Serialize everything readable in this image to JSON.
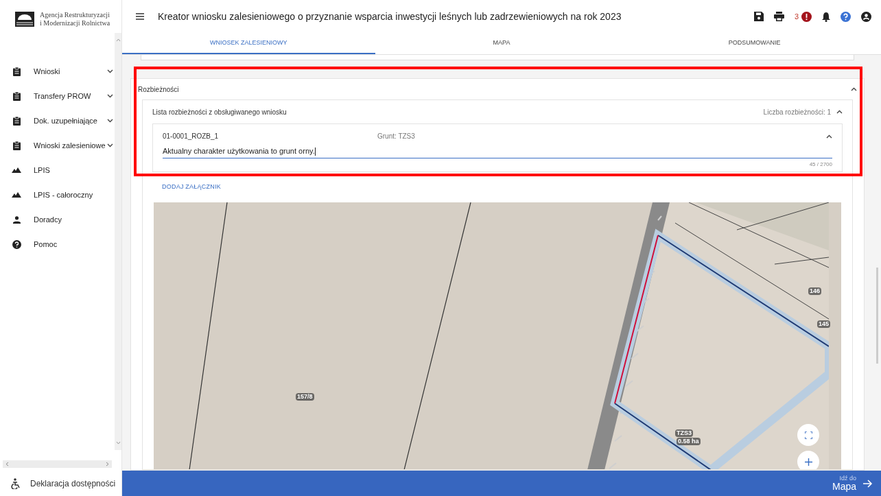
{
  "sidebar": {
    "logo_text": [
      "Agencja Restrukturyzacji",
      "i Modernizacji Rolnictwa"
    ],
    "items": [
      {
        "label": "Wnioski",
        "kind": "submenu"
      },
      {
        "label": "Transfery PROW",
        "kind": "submenu"
      },
      {
        "label": "Dok. uzupełniające",
        "kind": "submenu"
      },
      {
        "label": "Wnioski zalesieniowe",
        "kind": "submenu"
      },
      {
        "label": "LPIS",
        "kind": "link"
      },
      {
        "label": "LPIS - całoroczny",
        "kind": "link"
      },
      {
        "label": "Doradcy",
        "kind": "link"
      },
      {
        "label": "Pomoc",
        "kind": "link"
      }
    ],
    "footer_link": "Deklaracja dostępności"
  },
  "header": {
    "title": "Kreator wniosku zalesieniowego o przyznanie wsparcia inwestycji leśnych lub zadrzewieniowych na rok 2023",
    "error_count": "3"
  },
  "tabs": [
    {
      "label": "WNIOSEK ZALESIENIOWY",
      "selected": true
    },
    {
      "label": "MAPA",
      "selected": false
    },
    {
      "label": "PODSUMOWANIE",
      "selected": false
    }
  ],
  "discrepancies": {
    "title": "Rozbieżności",
    "expanded": true,
    "list": {
      "title": "Lista rozbieżności z obsługiwanego wniosku",
      "count_label": "Liczba rozbieżności: 1",
      "expanded": true,
      "items": [
        {
          "id": "01-0001_ROZB_1",
          "parcel": "Grunt: TZS3",
          "expanded": true,
          "description": "Aktualny charakter użytkowania to grunt orny.",
          "char_count": "45 / 2700"
        }
      ]
    },
    "attach_button": "DODAJ ZAŁĄCZNIK"
  },
  "map": {
    "labels": [
      {
        "text": "157/8"
      },
      {
        "text": "146"
      },
      {
        "text": "145"
      },
      {
        "text": "TZS3"
      },
      {
        "text": "0.58 ha"
      }
    ]
  },
  "footer_nav": {
    "caption": "Idź do",
    "target": "Mapa"
  }
}
